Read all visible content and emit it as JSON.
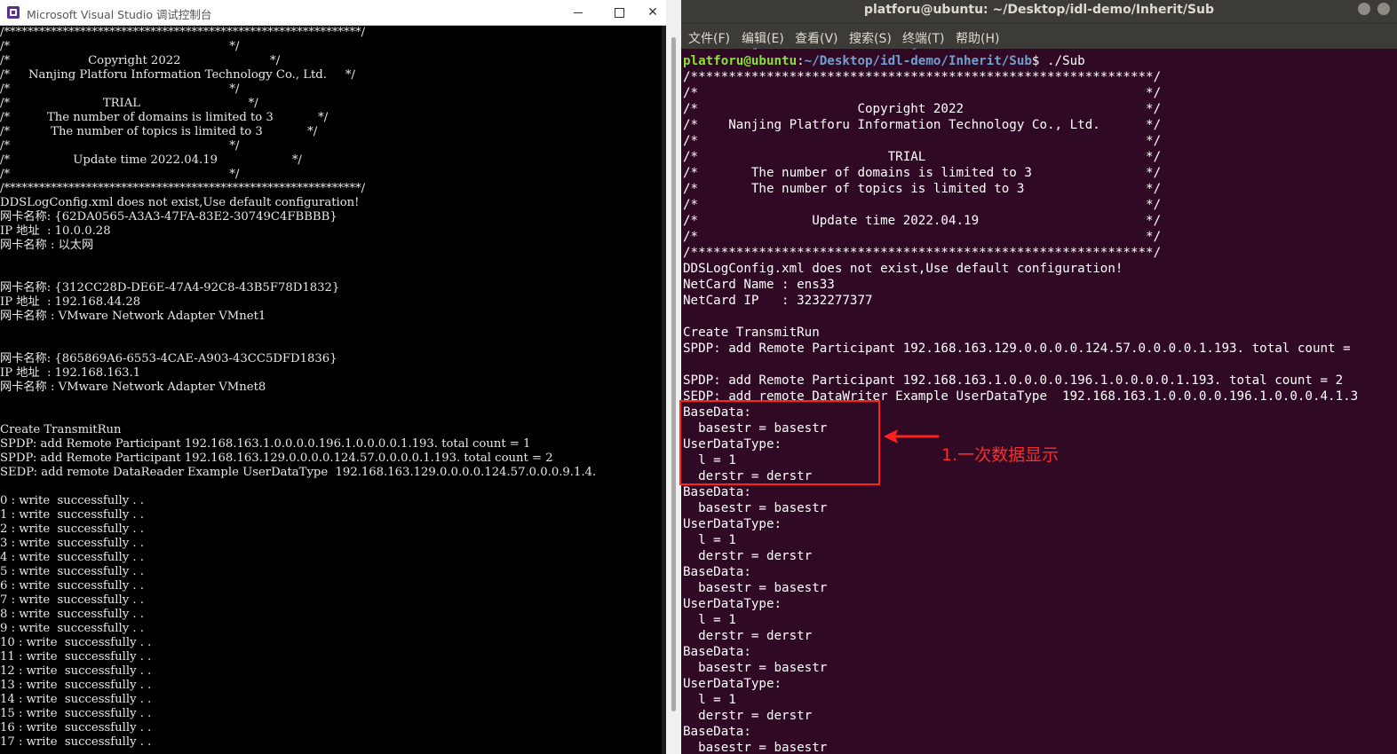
{
  "left_window": {
    "title": "Microsoft Visual Studio 调试控制台",
    "buttons": {
      "minimize": "—",
      "maximize": "□",
      "close": "✕"
    },
    "lines": [
      "/*************************************************************/",
      "/*                                                           */",
      "/*                     Copyright 2022                        */",
      "/*     Nanjing Platforu Information Technology Co., Ltd.     */",
      "/*                                                           */",
      "/*                         TRIAL                             */",
      "/*          The number of domains is limited to 3            */",
      "/*           The number of topics is limited to 3            */",
      "/*                                                           */",
      "/*                 Update time 2022.04.19                    */",
      "/*                                                           */",
      "/*************************************************************/",
      "DDSLogConfig.xml does not exist,Use default configuration!",
      "网卡名称: {62DA0565-A3A3-47FA-83E2-30749C4FBBBB}",
      "IP 地址  : 10.0.0.28",
      "网卡名称 : 以太网",
      "",
      "",
      "网卡名称: {312CC28D-DE6E-47A4-92C8-43B5F78D1832}",
      "IP 地址  : 192.168.44.28",
      "网卡名称 : VMware Network Adapter VMnet1",
      "",
      "",
      "网卡名称: {865869A6-6553-4CAE-A903-43CC5DFD1836}",
      "IP 地址  : 192.168.163.1",
      "网卡名称 : VMware Network Adapter VMnet8",
      "",
      "",
      "Create TransmitRun",
      "SPDP: add Remote Participant 192.168.163.1.0.0.0.0.196.1.0.0.0.0.1.193. total count = 1",
      "SPDP: add Remote Participant 192.168.163.129.0.0.0.0.124.57.0.0.0.0.1.193. total count = 2",
      "SEDP: add remote DataReader Example UserDataType  192.168.163.129.0.0.0.0.124.57.0.0.0.9.1.4.",
      "",
      "0 : write  successfully . .",
      "1 : write  successfully . .",
      "2 : write  successfully . .",
      "3 : write  successfully . .",
      "4 : write  successfully . .",
      "5 : write  successfully . .",
      "6 : write  successfully . .",
      "7 : write  successfully . .",
      "8 : write  successfully . .",
      "9 : write  successfully . .",
      "10 : write  successfully . .",
      "11 : write  successfully . .",
      "12 : write  successfully . .",
      "13 : write  successfully . .",
      "14 : write  successfully . .",
      "15 : write  successfully . .",
      "16 : write  successfully . .",
      "17 : write  successfully . ."
    ]
  },
  "right_window": {
    "title": "platforu@ubuntu: ~/Desktop/idl-demo/Inherit/Sub",
    "menu": [
      "文件(F)",
      "编辑(E)",
      "查看(V)",
      "搜索(S)",
      "终端(T)",
      "帮助(H)"
    ],
    "prompt": {
      "user": "platforu@ubuntu",
      "sep": ":",
      "path": "~/Desktop/idl-demo/Inherit/Sub",
      "cmd": "$ ./Sub"
    },
    "partial_top_line": "         -                    -             ",
    "lines": [
      "/*************************************************************/",
      "/*                                                           */",
      "/*                     Copyright 2022                        */",
      "/*    Nanjing Platforu Information Technology Co., Ltd.      */",
      "/*                                                           */",
      "/*                         TRIAL                             */",
      "/*       The number of domains is limited to 3               */",
      "/*       The number of topics is limited to 3                */",
      "/*                                                           */",
      "/*               Update time 2022.04.19                      */",
      "/*                                                           */",
      "/*************************************************************/",
      "DDSLogConfig.xml does not exist,Use default configuration!",
      "NetCard Name : ens33",
      "NetCard IP   : 3232277377",
      "",
      "Create TransmitRun",
      "SPDP: add Remote Participant 192.168.163.129.0.0.0.0.124.57.0.0.0.0.1.193. total count = ",
      "",
      "SPDP: add Remote Participant 192.168.163.1.0.0.0.0.196.1.0.0.0.0.1.193. total count = 2",
      "SEDP: add remote DataWriter Example UserDataType  192.168.163.1.0.0.0.0.196.1.0.0.0.4.1.3",
      "BaseData:",
      "  basestr = basestr",
      "UserDataType:",
      "  l = 1",
      "  derstr = derstr",
      "BaseData:",
      "  basestr = basestr",
      "UserDataType:",
      "  l = 1",
      "  derstr = derstr",
      "BaseData:",
      "  basestr = basestr",
      "UserDataType:",
      "  l = 1",
      "  derstr = derstr",
      "BaseData:",
      "  basestr = basestr",
      "UserDataType:",
      "  l = 1",
      "  derstr = derstr",
      "BaseData:",
      "  basestr = basestr"
    ]
  },
  "annotation": {
    "label": "1.一次数据显示",
    "color": "#ff2020"
  }
}
